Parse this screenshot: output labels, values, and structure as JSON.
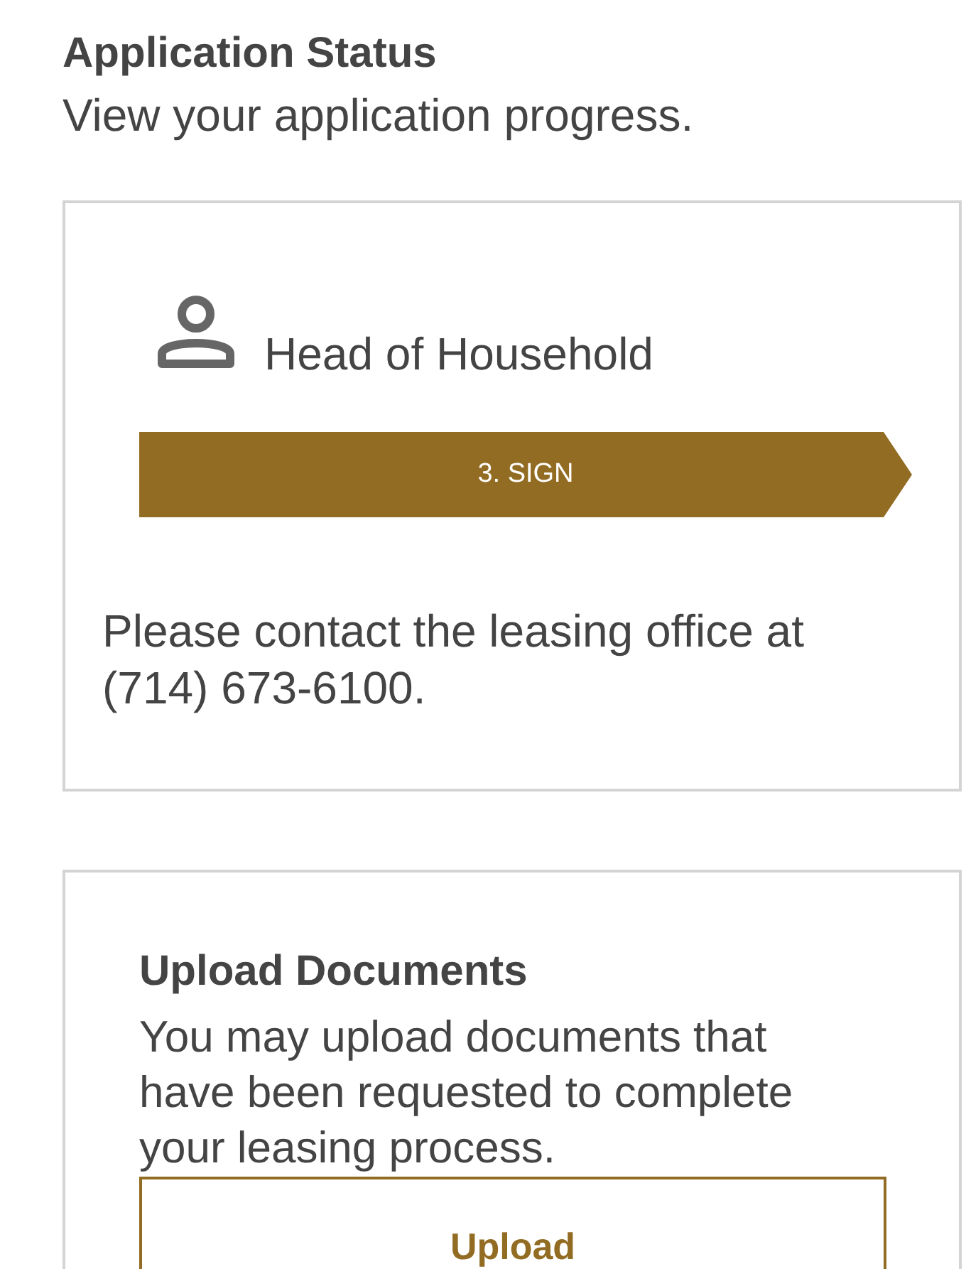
{
  "header": {
    "title": "Application Status",
    "subtitle": "View your application progress."
  },
  "status_card": {
    "role": "Head of Household",
    "step": "3. SIGN",
    "message": "Please contact the leasing office at (714) 673-6100."
  },
  "upload_card": {
    "title": "Upload Documents",
    "description": "You may upload documents that have been requested to complete your leasing process.",
    "button": "Upload"
  }
}
